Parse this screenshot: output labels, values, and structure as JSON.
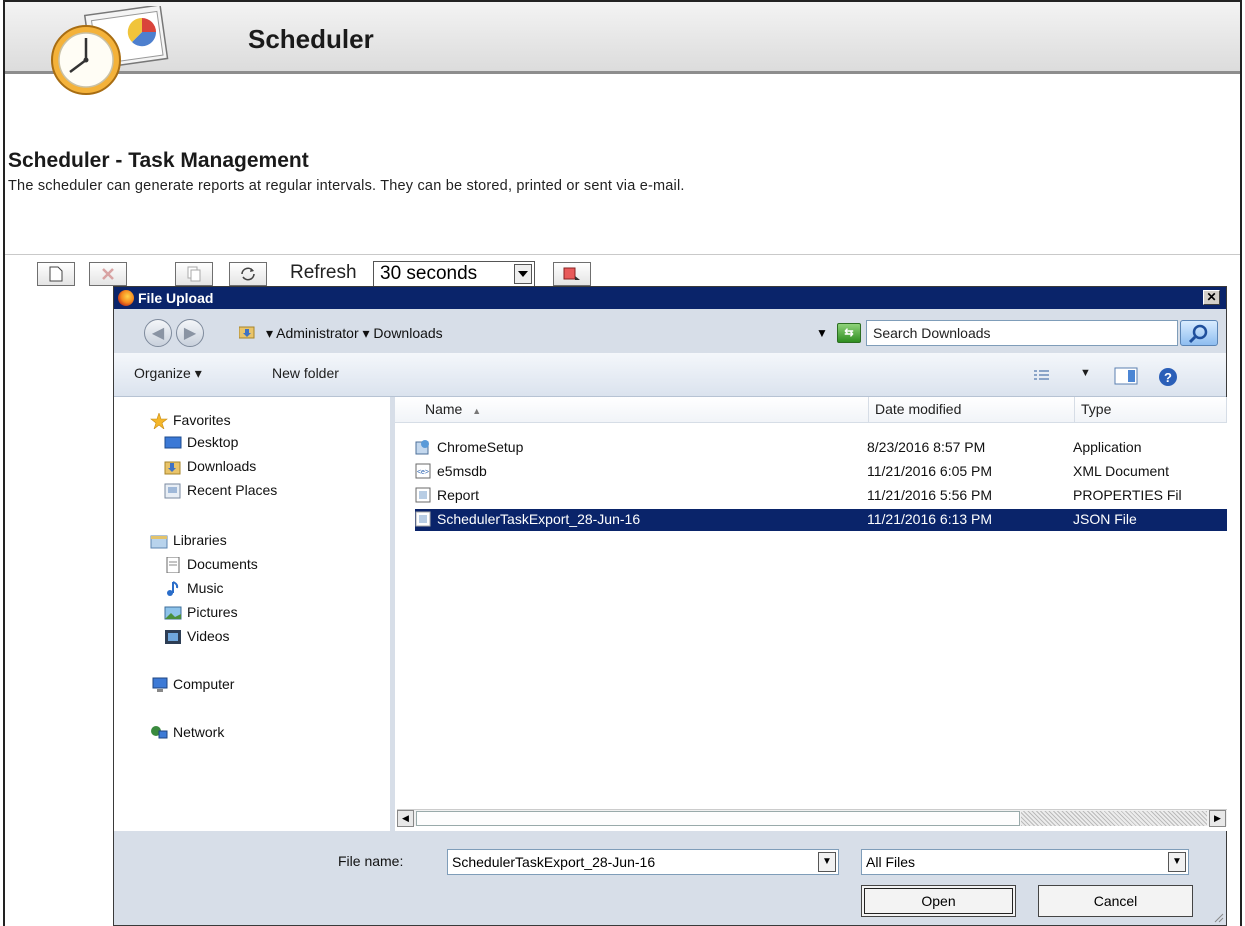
{
  "app": {
    "title": "Scheduler",
    "section_title": "Scheduler - Task Management",
    "section_desc": "The scheduler can generate reports at regular intervals. They can be stored, printed or sent via e-mail."
  },
  "toolbar": {
    "refresh_label": "Refresh",
    "refresh_value": "30 seconds"
  },
  "dialog": {
    "title": "File Upload",
    "address": "▾ Administrator ▾ Downloads",
    "search_placeholder": "Search Downloads",
    "commands": {
      "organize": "Organize ▾",
      "new_folder": "New folder"
    },
    "nav": {
      "favorites": "Favorites",
      "desktop": "Desktop",
      "downloads": "Downloads",
      "recent": "Recent Places",
      "libraries": "Libraries",
      "documents": "Documents",
      "music": "Music",
      "pictures": "Pictures",
      "videos": "Videos",
      "computer": "Computer",
      "network": "Network"
    },
    "columns": {
      "name": "Name",
      "date": "Date modified",
      "type": "Type"
    },
    "files": [
      {
        "name": "ChromeSetup",
        "date": "8/23/2016 8:57 PM",
        "type": "Application"
      },
      {
        "name": "e5msdb",
        "date": "11/21/2016 6:05 PM",
        "type": "XML Document"
      },
      {
        "name": "Report",
        "date": "11/21/2016 5:56 PM",
        "type": "PROPERTIES Fil"
      },
      {
        "name": "SchedulerTaskExport_28-Jun-16",
        "date": "11/21/2016 6:13 PM",
        "type": "JSON File"
      }
    ],
    "file_name_label": "File name:",
    "file_name_value": "SchedulerTaskExport_28-Jun-16",
    "filter_value": "All Files",
    "open_label": "Open",
    "cancel_label": "Cancel"
  },
  "colors": {
    "selection": "#0a246a",
    "titlebar": "#0a246a"
  }
}
